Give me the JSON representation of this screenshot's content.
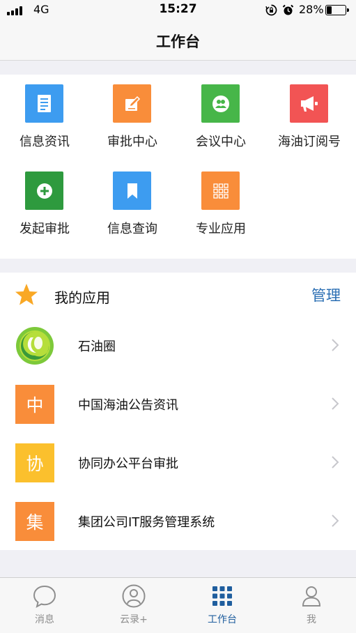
{
  "status_bar": {
    "carrier": "4G",
    "time": "15:27",
    "battery": "28%",
    "battery_level": 0.28,
    "icons": [
      "signal-icon",
      "orientation-lock-icon",
      "alarm-icon",
      "battery-icon"
    ]
  },
  "header": {
    "title": "工作台"
  },
  "grid": {
    "items": [
      {
        "label": "信息资讯",
        "icon": "document-icon",
        "color": "#3d9cf0"
      },
      {
        "label": "审批中心",
        "icon": "edit-icon",
        "color": "#f98d3a"
      },
      {
        "label": "会议中心",
        "icon": "people-icon",
        "color": "#47b649"
      },
      {
        "label": "海油订阅号",
        "icon": "megaphone-icon",
        "color": "#f25454"
      },
      {
        "label": "发起审批",
        "icon": "plus-circle-icon",
        "color": "#2e9a3e"
      },
      {
        "label": "信息查询",
        "icon": "bookmark-icon",
        "color": "#3d9cf0"
      },
      {
        "label": "专业应用",
        "icon": "grid-icon",
        "color": "#f98d3a"
      }
    ]
  },
  "my_apps": {
    "title": "我的应用",
    "manage": "管理",
    "items": [
      {
        "label": "石油圈",
        "icon": "oil-circle-logo-icon",
        "glyph": ""
      },
      {
        "label": "中国海油公告资讯",
        "icon": "character-tile-icon",
        "glyph": "中",
        "color": "#f98d3a"
      },
      {
        "label": "协同办公平台审批",
        "icon": "character-tile-icon",
        "glyph": "协",
        "color": "#fbc02d"
      },
      {
        "label": "集团公司IT服务管理系统",
        "icon": "character-tile-icon",
        "glyph": "集",
        "color": "#f98d3a"
      }
    ]
  },
  "tab_bar": {
    "tabs": [
      {
        "label": "消息",
        "icon": "chat-bubble-icon",
        "active": false
      },
      {
        "label": "云录+",
        "icon": "contact-icon",
        "active": false
      },
      {
        "label": "工作台",
        "icon": "grid-dots-icon",
        "active": true
      },
      {
        "label": "我",
        "icon": "person-icon",
        "active": false
      }
    ]
  },
  "colors": {
    "accent": "#1f5e9e",
    "link": "#2a6eb3",
    "star": "#f9a825",
    "background": "#f0f0f5"
  }
}
